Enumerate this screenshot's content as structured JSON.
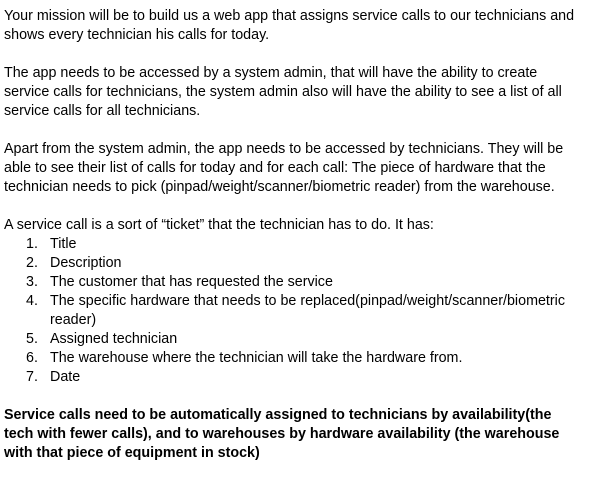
{
  "document": {
    "paragraphs": [
      "Your mission will be to build us a web app that assigns service calls to our technicians and shows every technician his calls for today.",
      "The app needs to be accessed by a system admin, that will have the ability to create service calls for technicians, the system admin also will have the ability to see a list of all service calls for all technicians.",
      "Apart from the system admin, the app needs to be accessed by technicians. They will be able to see their list of calls for today and for each call: The piece of hardware that the technician needs to pick (pinpad/weight/scanner/biometric reader) from the warehouse."
    ],
    "list_intro": "A service call is a sort of “ticket” that the technician has to do. It has:",
    "list_items": [
      {
        "num": "1.",
        "text": "Title"
      },
      {
        "num": "2.",
        "text": "Description"
      },
      {
        "num": "3.",
        "text": "The customer that has requested the service"
      },
      {
        "num": "4.",
        "text": "The specific hardware that needs to be replaced(pinpad/weight/scanner/biometric reader)"
      },
      {
        "num": "5.",
        "text": "Assigned technician"
      },
      {
        "num": "6.",
        "text": "The warehouse where the technician will take the hardware from."
      },
      {
        "num": "7.",
        "text": "Date"
      }
    ],
    "closing_bold": "Service calls need to be automatically assigned to technicians by availability(the tech with fewer calls), and to warehouses by hardware availability (the warehouse with that piece of equipment in stock)"
  }
}
